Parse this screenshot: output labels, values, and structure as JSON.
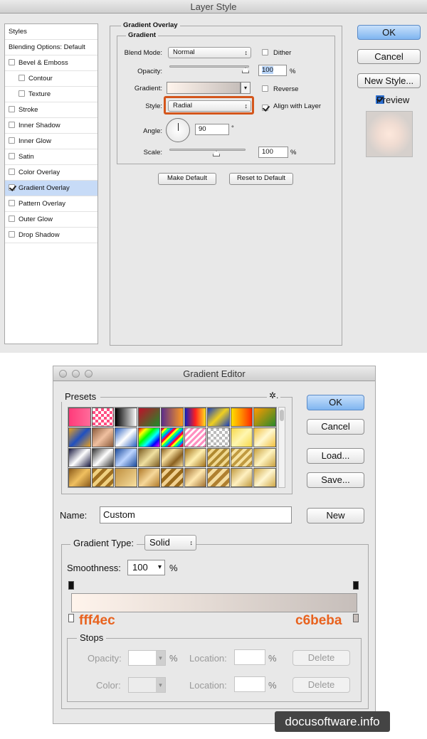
{
  "layer_style": {
    "title": "Layer Style",
    "styles_items": [
      {
        "label": "Styles",
        "checkbox": false,
        "checked": false,
        "indent": false,
        "selected": false
      },
      {
        "label": "Blending Options: Default",
        "checkbox": false,
        "checked": false,
        "indent": false,
        "selected": false
      },
      {
        "label": "Bevel & Emboss",
        "checkbox": true,
        "checked": false,
        "indent": false,
        "selected": false
      },
      {
        "label": "Contour",
        "checkbox": true,
        "checked": false,
        "indent": true,
        "selected": false
      },
      {
        "label": "Texture",
        "checkbox": true,
        "checked": false,
        "indent": true,
        "selected": false
      },
      {
        "label": "Stroke",
        "checkbox": true,
        "checked": false,
        "indent": false,
        "selected": false
      },
      {
        "label": "Inner Shadow",
        "checkbox": true,
        "checked": false,
        "indent": false,
        "selected": false
      },
      {
        "label": "Inner Glow",
        "checkbox": true,
        "checked": false,
        "indent": false,
        "selected": false
      },
      {
        "label": "Satin",
        "checkbox": true,
        "checked": false,
        "indent": false,
        "selected": false
      },
      {
        "label": "Color Overlay",
        "checkbox": true,
        "checked": false,
        "indent": false,
        "selected": false
      },
      {
        "label": "Gradient Overlay",
        "checkbox": true,
        "checked": true,
        "indent": false,
        "selected": true
      },
      {
        "label": "Pattern Overlay",
        "checkbox": true,
        "checked": false,
        "indent": false,
        "selected": false
      },
      {
        "label": "Outer Glow",
        "checkbox": true,
        "checked": false,
        "indent": false,
        "selected": false
      },
      {
        "label": "Drop Shadow",
        "checkbox": true,
        "checked": false,
        "indent": false,
        "selected": false
      }
    ],
    "section_title": "Gradient Overlay",
    "group_title": "Gradient",
    "blend_mode_label": "Blend Mode:",
    "blend_mode_value": "Normal",
    "dither_label": "Dither",
    "opacity_label": "Opacity:",
    "opacity_value": "100",
    "percent": "%",
    "gradient_label": "Gradient:",
    "reverse_label": "Reverse",
    "style_label": "Style:",
    "style_value": "Radial",
    "align_label": "Align with Layer",
    "angle_label": "Angle:",
    "angle_value": "90",
    "degree": "°",
    "scale_label": "Scale:",
    "scale_value": "100",
    "make_default": "Make Default",
    "reset_default": "Reset to Default",
    "ok": "OK",
    "cancel": "Cancel",
    "new_style": "New Style...",
    "preview": "Preview",
    "highlight_color": "#d4561c"
  },
  "gradient_editor": {
    "title": "Gradient Editor",
    "presets_label": "Presets",
    "gear": "✲.",
    "ok": "OK",
    "cancel": "Cancel",
    "load": "Load...",
    "save": "Save...",
    "name_label": "Name:",
    "name_value": "Custom",
    "new": "New",
    "gradient_type_label": "Gradient Type:",
    "gradient_type_value": "Solid",
    "smoothness_label": "Smoothness:",
    "smoothness_value": "100",
    "percent": "%",
    "start_color": "fff4ec",
    "end_color": "c6beba",
    "stops_label": "Stops",
    "opacity_label": "Opacity:",
    "color_label": "Color:",
    "location_label": "Location:",
    "delete": "Delete",
    "presets": [
      "linear-gradient(to right,#ff3b7a,#ff6b9a)",
      "repeating-conic-gradient(#ff4d80 0 25%,#fff 0 50%) 0 0/8px 8px",
      "linear-gradient(to right,#000,#fff)",
      "linear-gradient(135deg,#c0102a,#1f8a2a)",
      "linear-gradient(to right,#5b2d8a,#ff9a1f)",
      "linear-gradient(to right,#1020c0,#ff2020,#ffe020)",
      "linear-gradient(135deg,#1840c0,#f0d020,#1840c0)",
      "linear-gradient(to right,#ffe000,#ff8a00,#ff2a00)",
      "linear-gradient(135deg,#ff9a00,#2a8a2a)",
      "linear-gradient(135deg,#e8a020,#2050c0,#e8a020)",
      "linear-gradient(135deg,#8a5a3a,#f0c0a0,#8a5a3a)",
      "linear-gradient(135deg,#2a60c0,#ffffff,#2a60c0)",
      "linear-gradient(135deg,#ff0000,#ffff00,#00ff00,#00ffff,#0000ff,#ff00ff)",
      "repeating-linear-gradient(135deg,#ff0040 0 3px,#ffff00 3px 6px,#00ff80 6px 9px,#0080ff 9px 12px)",
      "repeating-linear-gradient(135deg,#ff8fc0 0 3px,#fff 3px 6px)",
      "repeating-conic-gradient(#bbb 0 25%,#fff 0 50%) 0 0/8px 8px",
      "linear-gradient(135deg,#f6d84a,#fff6b0,#f6d84a)",
      "linear-gradient(135deg,#f0c040,#fff8d0,#f0c040)",
      "linear-gradient(135deg,#1a1a40,#ffffff,#1a1a40)",
      "linear-gradient(135deg,#333,#fff,#333)",
      "linear-gradient(135deg,#1a4a9a,#bcd4ff,#1a4a9a)",
      "linear-gradient(135deg,#7a5a20,#f0e0a0,#7a5a20)",
      "linear-gradient(135deg,#8a6020,#f8e0a0,#8a6020,#f8e0a0)",
      "linear-gradient(135deg,#a0701a,#fff0b0,#a0701a)",
      "repeating-linear-gradient(135deg,#b08a30 0 4px,#f0d890 4px 8px)",
      "repeating-linear-gradient(135deg,#c09a40 0 4px,#f6e2a0 4px 8px)",
      "linear-gradient(135deg,#c8a040,#fff4c0,#c8a040)",
      "linear-gradient(135deg,#8a5a1a,#f0c060,#8a5a1a)",
      "repeating-linear-gradient(135deg,#a07020 0 5px,#f0d080 5px 10px)",
      "linear-gradient(135deg,#c09040,#f8e0a0)",
      "linear-gradient(135deg,#b07a2a,#f6d89a,#b07a2a)",
      "repeating-linear-gradient(135deg,#9a6a1a 0 5px,#f0d090 5px 10px)",
      "linear-gradient(135deg,#a07030,#ffe8b0,#a07030)",
      "repeating-linear-gradient(135deg,#b08030 0 5px,#f4dca0 5px 10px)",
      "linear-gradient(135deg,#c09a40,#fff0c0,#c09a40)",
      "linear-gradient(135deg,#d0a848,#fff6d0,#d0a848)"
    ]
  },
  "watermark": "docusoftware.info"
}
